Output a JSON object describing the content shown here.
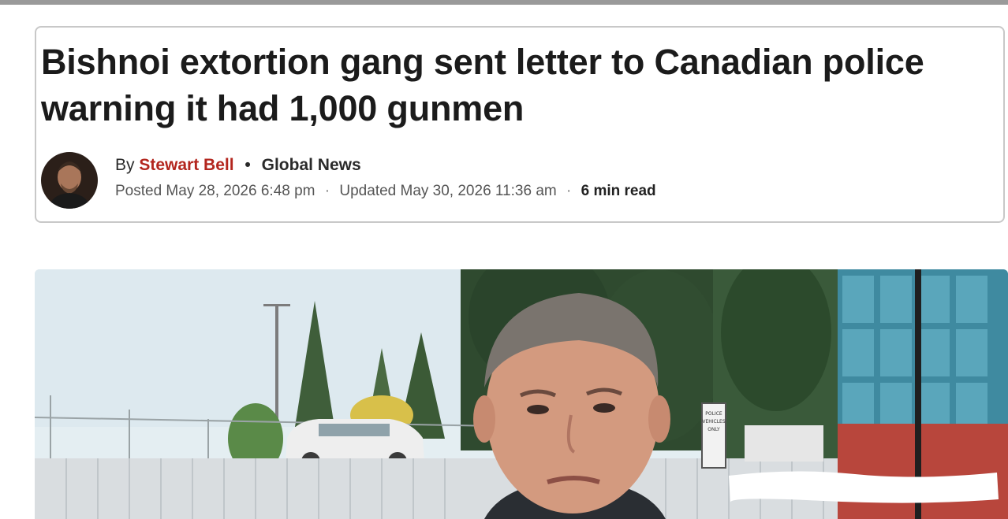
{
  "article": {
    "headline": "Bishnoi extortion gang sent letter to Canadian police warning it had 1,000 gunmen",
    "byline": {
      "prefix": "By",
      "author": "Stewart Bell",
      "separator": "•",
      "source": "Global News"
    },
    "meta": {
      "posted": "Posted May 28, 2026 6:48 pm",
      "updated": "Updated May 30, 2026 11:36 am",
      "read_time": "6 min read",
      "separator": "·"
    },
    "hero_image": {
      "sign_text": [
        "POLICE",
        "VEHICLES",
        "ONLY"
      ]
    }
  }
}
